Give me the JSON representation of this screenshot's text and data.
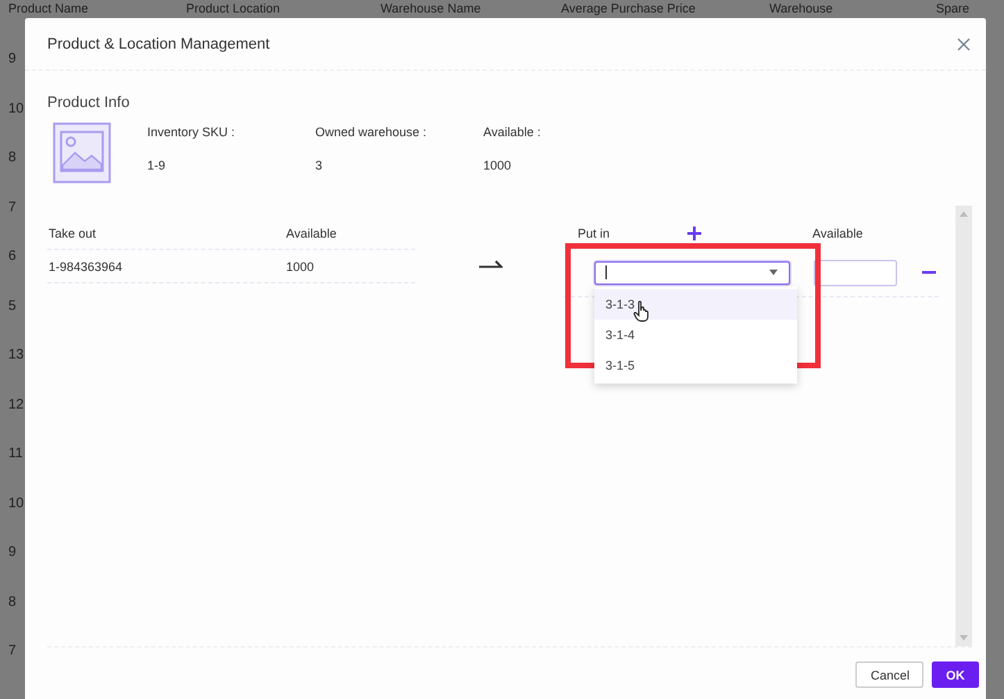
{
  "background_table": {
    "columns": [
      "Product Name",
      "Product Location",
      "Warehouse Name",
      "Average Purchase Price",
      "Warehouse",
      "Spare"
    ],
    "row_numbers": [
      "9",
      "10",
      "8",
      "7",
      "6",
      "5",
      "13",
      "12",
      "11",
      "10",
      "9",
      "8",
      "7"
    ]
  },
  "dialog": {
    "title": "Product & Location Management",
    "product_info": {
      "heading": "Product Info",
      "fields": [
        {
          "label": "Inventory SKU :",
          "value": "1-9"
        },
        {
          "label": "Owned warehouse :",
          "value": "3"
        },
        {
          "label": "Available :",
          "value": "1000"
        }
      ]
    },
    "take_out": {
      "columns": [
        "Take out",
        "Available"
      ],
      "rows": [
        [
          "1-984363964",
          "1000"
        ]
      ]
    },
    "put_in": {
      "columns": [
        "Put in",
        "Available"
      ],
      "rows": [
        {
          "location": {
            "focused": true,
            "open": true,
            "options": [
              {
                "label": "3-1-3",
                "hovered": true
              },
              {
                "label": "3-1-4",
                "hovered": false
              },
              {
                "label": "3-1-5",
                "hovered": false
              }
            ]
          }
        }
      ]
    },
    "buttons": [
      {
        "label": "Cancel",
        "kind": "secondary"
      },
      {
        "label": "OK",
        "kind": "primary"
      }
    ]
  }
}
